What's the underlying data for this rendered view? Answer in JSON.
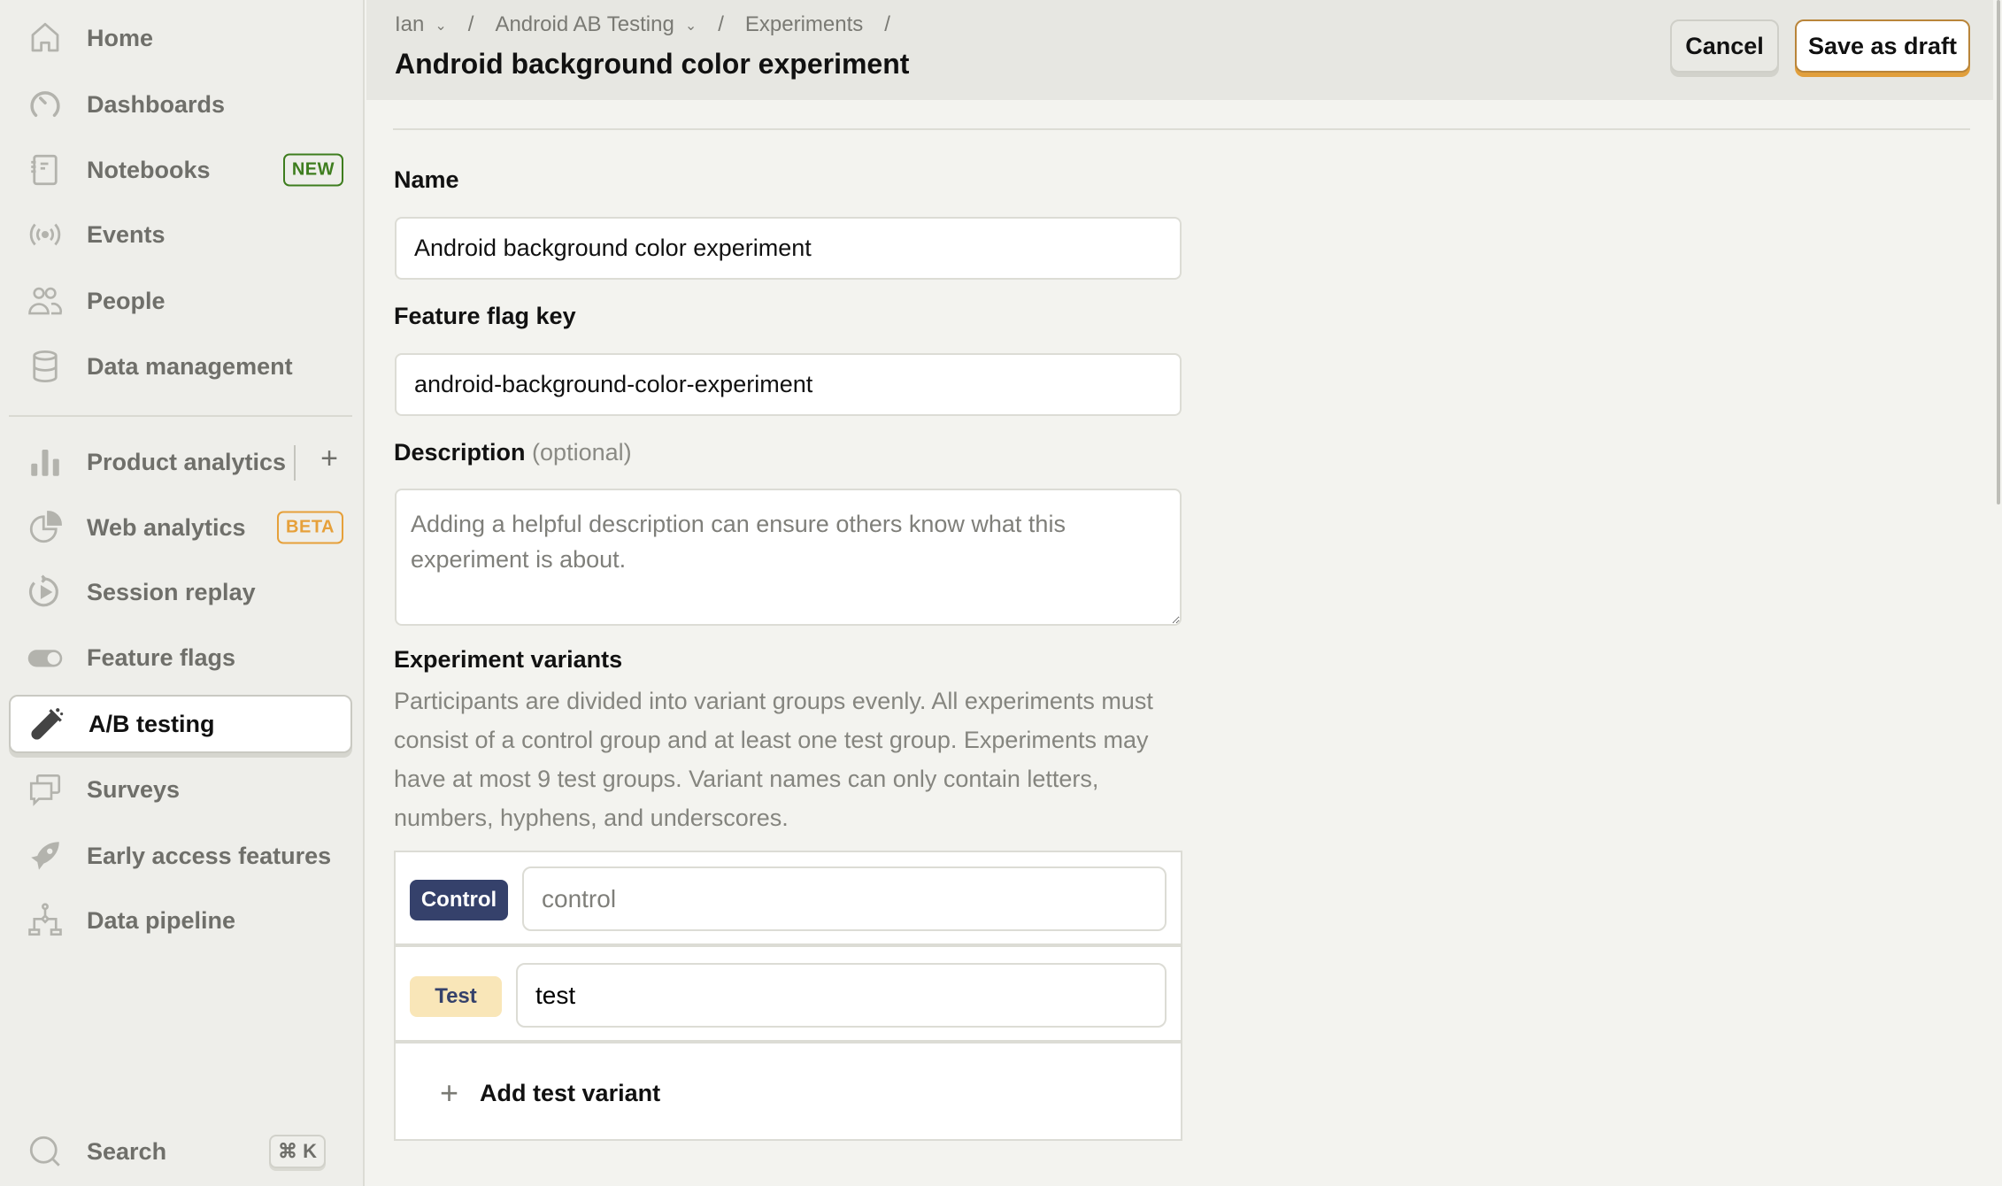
{
  "sidebar": {
    "items": [
      {
        "label": "Home",
        "icon": "home-icon"
      },
      {
        "label": "Dashboards",
        "icon": "dashboard-icon"
      },
      {
        "label": "Notebooks",
        "icon": "notebook-icon",
        "badge": "NEW"
      },
      {
        "label": "Events",
        "icon": "broadcast-icon"
      },
      {
        "label": "People",
        "icon": "people-icon"
      },
      {
        "label": "Data management",
        "icon": "database-icon"
      },
      {
        "label": "Product analytics",
        "icon": "bar-chart-icon",
        "action": "+"
      },
      {
        "label": "Web analytics",
        "icon": "pie-chart-icon",
        "badge": "BETA"
      },
      {
        "label": "Session replay",
        "icon": "replay-icon"
      },
      {
        "label": "Feature flags",
        "icon": "toggle-icon"
      },
      {
        "label": "A/B testing",
        "icon": "flask-icon",
        "active": true
      },
      {
        "label": "Surveys",
        "icon": "survey-icon"
      },
      {
        "label": "Early access features",
        "icon": "rocket-icon"
      },
      {
        "label": "Data pipeline",
        "icon": "pipeline-icon"
      }
    ],
    "search": {
      "label": "Search",
      "shortcut": "⌘ K"
    }
  },
  "header": {
    "breadcrumb": [
      {
        "label": "Ian",
        "dropdown": true
      },
      {
        "label": "Android AB Testing",
        "dropdown": true
      },
      {
        "label": "Experiments",
        "dropdown": false
      }
    ],
    "separator": "/",
    "title": "Android background color experiment",
    "cancel_label": "Cancel",
    "save_label": "Save as draft"
  },
  "form": {
    "name": {
      "label": "Name",
      "value": "Android background color experiment"
    },
    "flag_key": {
      "label": "Feature flag key",
      "value": "android-background-color-experiment"
    },
    "description": {
      "label": "Description",
      "optional": "(optional)",
      "value": "",
      "placeholder": "Adding a helpful description can ensure others know what this experiment is about."
    },
    "variants": {
      "title": "Experiment variants",
      "helper": "Participants are divided into variant groups evenly. All experiments must consist of a control group and at least one test group. Experiments may have at most 9 test groups. Variant names can only contain letters, numbers, hyphens, and underscores.",
      "rows": [
        {
          "tag": "Control",
          "value": "control",
          "disabled": true
        },
        {
          "tag": "Test",
          "value": "test",
          "disabled": false
        }
      ],
      "add_label": "Add test variant",
      "add_icon": "+"
    }
  },
  "colors": {
    "accent": "#e19f3c",
    "control_tag": "#35416b",
    "test_tag": "#f9e6b8",
    "new_badge": "#3e7d1e",
    "beta_badge": "#e6a03a"
  }
}
